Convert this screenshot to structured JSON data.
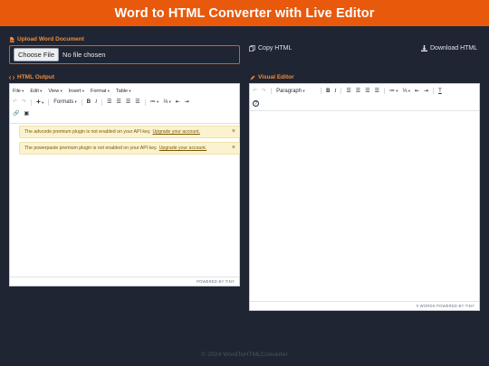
{
  "header": {
    "title": "Word to HTML Converter with Live Editor"
  },
  "upload": {
    "label": "Upload Word Document",
    "choose_button": "Choose File",
    "file_status": "No file chosen"
  },
  "actions": {
    "copy_html": "Copy HTML",
    "download_html": "Download HTML"
  },
  "html_output": {
    "label": "HTML Output",
    "menus": [
      "File",
      "Edit",
      "View",
      "Insert",
      "Format",
      "Table"
    ],
    "formats_label": "Formats",
    "notifications": [
      {
        "text": "The advcode premium plugin is not enabled on your API key.",
        "link": "Upgrade your account."
      },
      {
        "text": "The powerpaste premium plugin is not enabled on your API key.",
        "link": "Upgrade your account."
      }
    ],
    "status": "POWERED BY TINY"
  },
  "visual_editor": {
    "label": "Visual Editor",
    "block_format": "Paragraph",
    "status": "0 WORDS POWERED BY TINY"
  },
  "footer": {
    "text": "© 2024 WordToHTMLConverter"
  },
  "colors": {
    "accent": "#e8590c",
    "background": "#1f2533",
    "label": "#f08c3a"
  }
}
